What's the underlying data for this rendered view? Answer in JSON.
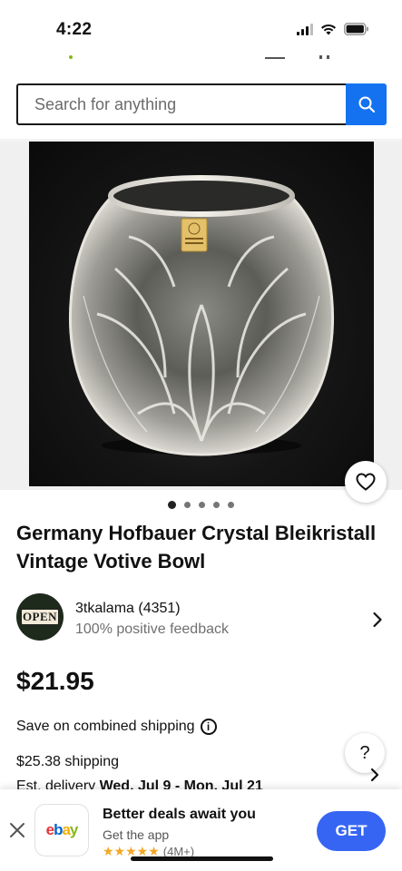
{
  "status_bar": {
    "time": "4:22"
  },
  "search": {
    "placeholder": "Search for anything",
    "button_icon": "search-icon"
  },
  "listing": {
    "image_count": 5,
    "active_image_index": 0,
    "title": "Germany Hofbauer Crystal Bleikristall Vintage Votive Bowl",
    "watch_icon": "heart-icon",
    "seller": {
      "name_and_score": "3tkalama (4351)",
      "feedback": "100% positive feedback",
      "avatar_text": "OPEN"
    },
    "price": "$21.95",
    "combined_shipping": "Save on combined shipping",
    "shipping": "$25.38 shipping",
    "delivery_prefix": "Est. delivery ",
    "delivery_dates": "Wed, Jul 9 - Mon, Jul 21"
  },
  "help_button": "?",
  "app_banner": {
    "title": "Better deals await you",
    "subtitle": "Get the app",
    "stars": "★★★★★",
    "rating_count": "(4M+)",
    "get_label": "GET",
    "logo": {
      "e": "e",
      "b": "b",
      "a": "a",
      "y": "y"
    }
  },
  "colors": {
    "accent": "#1472f0",
    "get_button": "#3665f3",
    "stars": "#f5a623"
  }
}
